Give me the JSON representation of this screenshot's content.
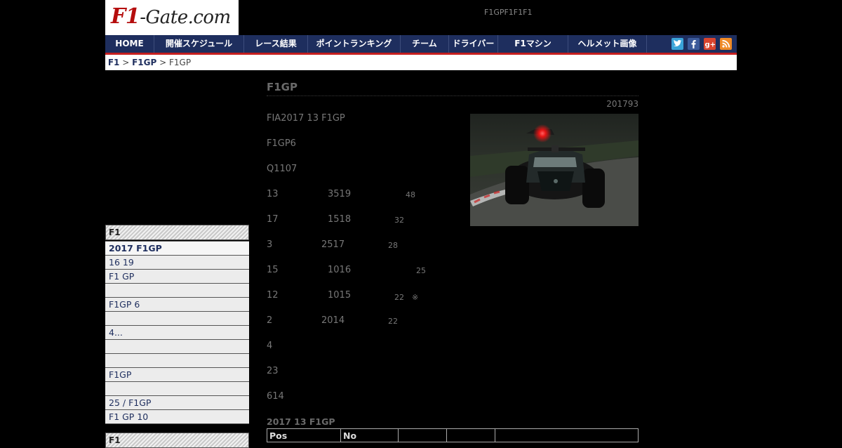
{
  "site": {
    "logo_main": "F1",
    "logo_rest": "-Gate.com",
    "tagline": "F1GPF1F1F1"
  },
  "nav": {
    "home": "HOME",
    "schedule": "開催スケジュール",
    "results": "レース結果",
    "ranking": "ポイントランキング",
    "team": "チーム",
    "driver": "ドライバー",
    "machine": "F1マシン",
    "helmet": "ヘルメット画像",
    "social_icons": [
      "twitter-icon",
      "facebook-icon",
      "google-plus-icon",
      "rss-icon"
    ]
  },
  "breadcrumb": {
    "item1": "F1",
    "sep1": ">",
    "item2": "F1GP",
    "sep2": ">",
    "current": "F1GP"
  },
  "sidebar": {
    "heading1": "F1",
    "items": [
      "2017 F1GP",
      " 16 19",
      " F1 GP",
      "",
      "F1GP 6",
      "",
      "4...",
      "",
      "",
      "F1GP",
      "",
      "25 / F1GP",
      "F1 GP 10"
    ],
    "heading2": "F1"
  },
  "article": {
    "title": "F1GP",
    "date": "201793",
    "paragraphs": [
      {
        "a": "FIA2017 13 F1GP",
        "b": "",
        "c": ""
      },
      {
        "a": "F1GP6",
        "b": "",
        "c": ""
      },
      {
        "a": "Q1107",
        "b": "",
        "c": ""
      },
      {
        "a": "13",
        "b": "3519",
        "c": "48"
      },
      {
        "a": "17",
        "b": "1518",
        "c": "32"
      },
      {
        "a": "3",
        "b": "2517",
        "c": "28"
      },
      {
        "a": "15",
        "b": "1016",
        "c": "25"
      },
      {
        "a": "12",
        "b": "1015",
        "c": "22　※"
      },
      {
        "a": "2",
        "b": "2014",
        "c": "22"
      },
      {
        "a": "4",
        "b": "",
        "c": ""
      },
      {
        "a": "23",
        "b": "",
        "c": ""
      },
      {
        "a": "614",
        "b": "",
        "c": ""
      }
    ],
    "result_title": "2017 13 F1GP",
    "table_headers": [
      "Pos",
      "No",
      "",
      "",
      ""
    ]
  }
}
